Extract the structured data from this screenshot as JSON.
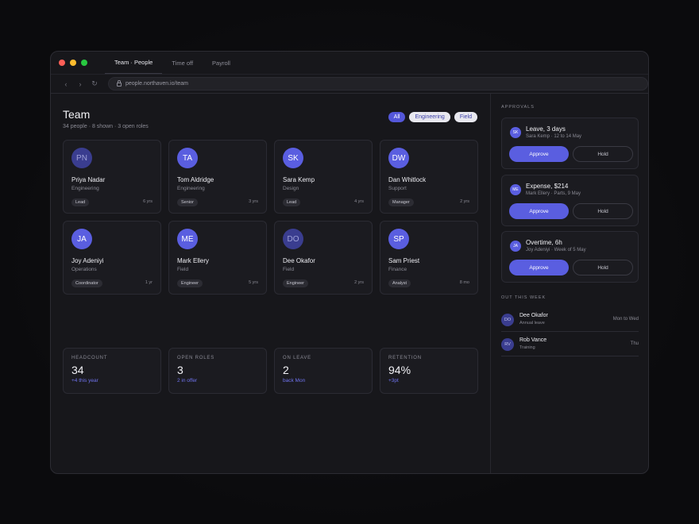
{
  "browser": {
    "tabs": [
      "Team · People",
      "Time off",
      "Payroll"
    ],
    "url": "people.northaven.io/team",
    "nav": {
      "back": "‹",
      "forward": "›",
      "reload": "↻"
    }
  },
  "header": {
    "title": "Team",
    "subtitle": "34 people · 8 shown · 3 open roles",
    "filters": [
      "All",
      "Engineering",
      "Field"
    ]
  },
  "people": [
    {
      "initials": "PN",
      "name": "Priya Nadar",
      "dept": "Engineering",
      "badge": "Lead",
      "tenure": "6 yrs"
    },
    {
      "initials": "TA",
      "name": "Tom Aldridge",
      "dept": "Engineering",
      "badge": "Senior",
      "tenure": "3 yrs"
    },
    {
      "initials": "SK",
      "name": "Sara Kemp",
      "dept": "Design",
      "badge": "Lead",
      "tenure": "4 yrs"
    },
    {
      "initials": "DW",
      "name": "Dan Whitlock",
      "dept": "Support",
      "badge": "Manager",
      "tenure": "2 yrs"
    },
    {
      "initials": "JA",
      "name": "Joy Adeniyi",
      "dept": "Operations",
      "badge": "Coordinator",
      "tenure": "1 yr"
    },
    {
      "initials": "ME",
      "name": "Mark Ellery",
      "dept": "Field",
      "badge": "Engineer",
      "tenure": "5 yrs"
    },
    {
      "initials": "DO",
      "name": "Dee Okafor",
      "dept": "Field",
      "badge": "Engineer",
      "tenure": "2 yrs"
    },
    {
      "initials": "SP",
      "name": "Sam Priest",
      "dept": "Finance",
      "badge": "Analyst",
      "tenure": "8 mo"
    }
  ],
  "stats": [
    {
      "label": "HEADCOUNT",
      "value": "34",
      "note": "+4 this year"
    },
    {
      "label": "OPEN ROLES",
      "value": "3",
      "note": "2 in offer"
    },
    {
      "label": "ON LEAVE",
      "value": "2",
      "note": "back Mon"
    },
    {
      "label": "RETENTION",
      "value": "94%",
      "note": "+3pt"
    }
  ],
  "approvals": {
    "title": "APPROVALS",
    "approve_label": "Approve",
    "hold_label": "Hold",
    "items": [
      {
        "initials": "SK",
        "title": "Leave, 3 days",
        "sub": "Sara Kemp · 12 to 14 May"
      },
      {
        "initials": "ME",
        "title": "Expense, $214",
        "sub": "Mark Ellery · Parts, 9 May"
      },
      {
        "initials": "JA",
        "title": "Overtime, 6h",
        "sub": "Joy Adeniyi · Week of 5 May"
      }
    ]
  },
  "out_this_week": {
    "title": "OUT THIS WEEK",
    "items": [
      {
        "initials": "DO",
        "name": "Dee Okafor",
        "type": "Annual leave",
        "when": "Mon to Wed"
      },
      {
        "initials": "RV",
        "name": "Rob Vance",
        "type": "Training",
        "when": "Thu"
      }
    ]
  },
  "colors": {
    "accent": "#5a5ee0",
    "background": "#17171b",
    "card": "#1b1b20"
  }
}
